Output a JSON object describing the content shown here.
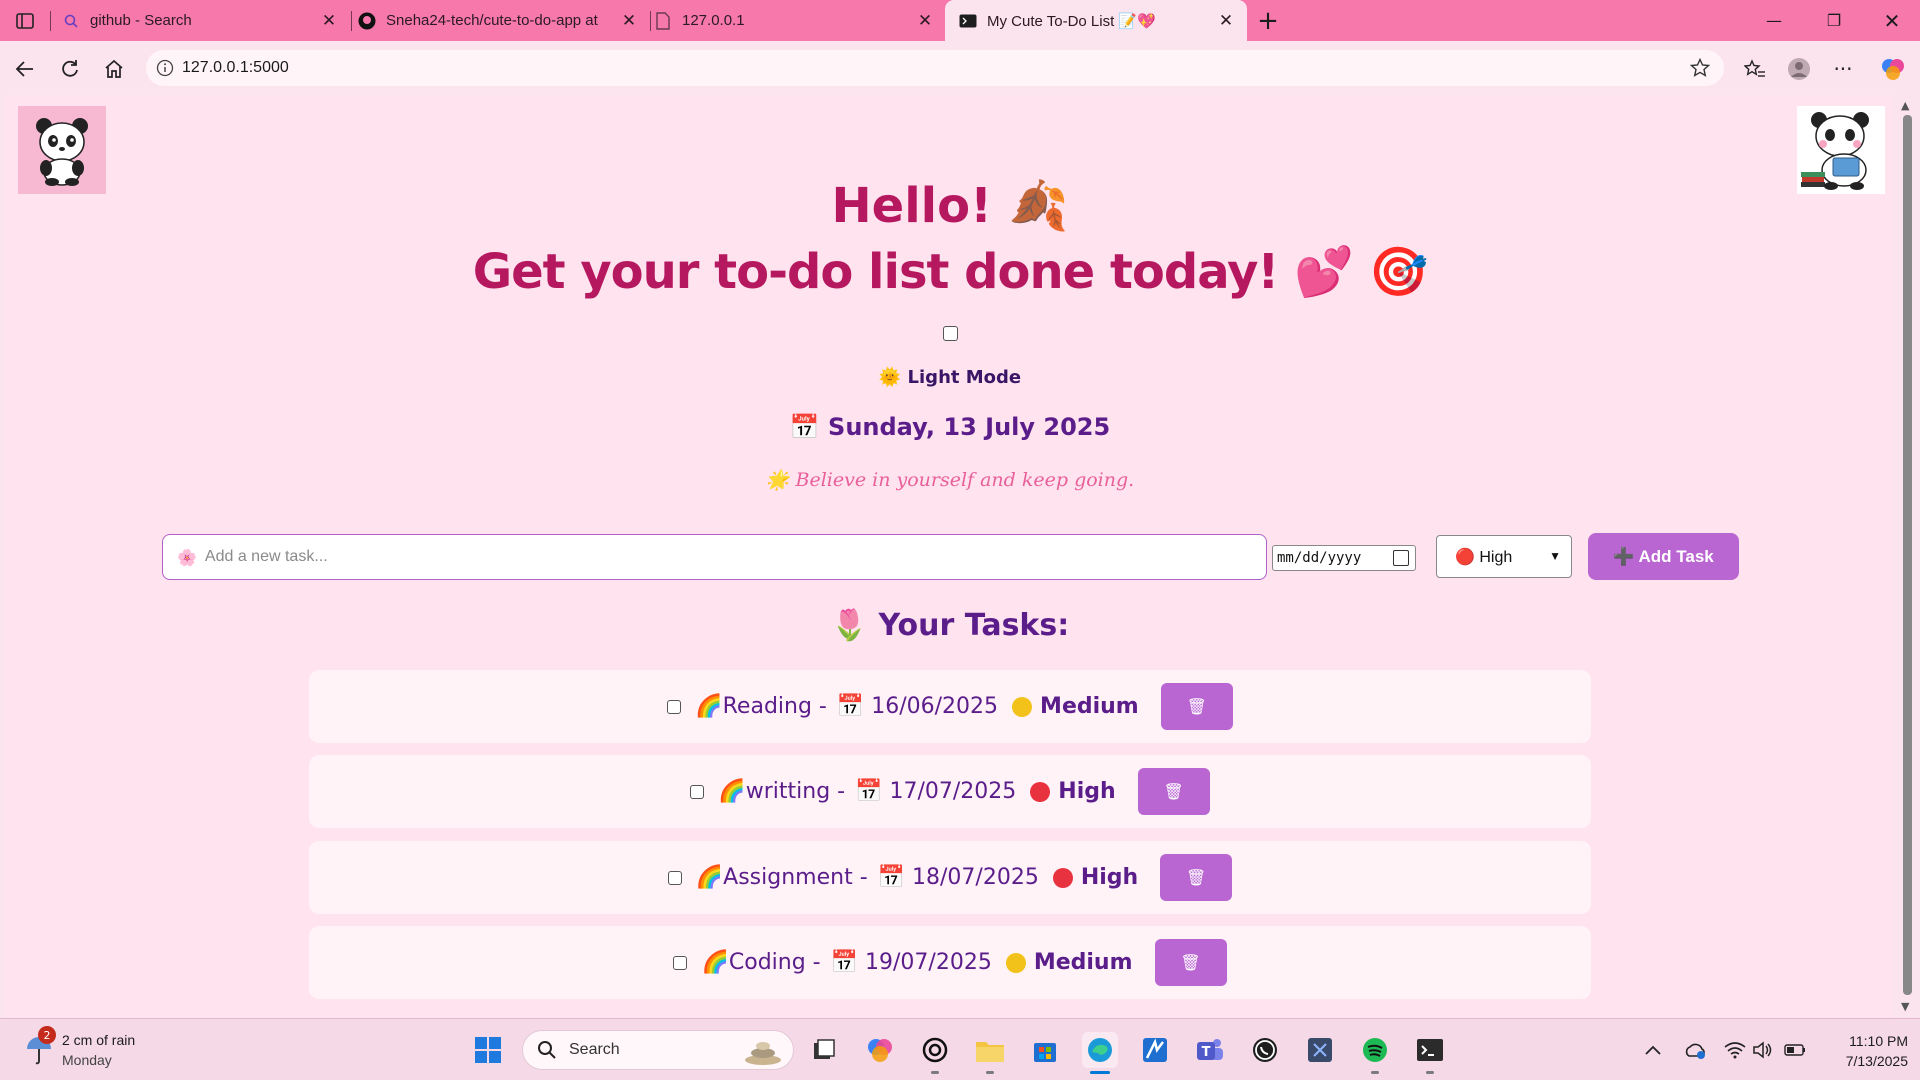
{
  "browser": {
    "tabs": [
      {
        "title": "github - Search",
        "icon": "search-icon"
      },
      {
        "title": "Sneha24-tech/cute-to-do-app at",
        "icon": "github-icon"
      },
      {
        "title": "127.0.0.1",
        "icon": "document-icon"
      },
      {
        "title": "My Cute To-Do List 📝💖",
        "icon": "terminal-icon",
        "active": true
      }
    ],
    "url": "127.0.0.1:5000"
  },
  "page": {
    "greeting": "Hello! 🍂",
    "headline": "Get your to-do list done today! 💕 🎯",
    "mode_label": "🌞 Light Mode",
    "date_label": "📅 Sunday, 13 July 2025",
    "quote": "🌟 Believe in yourself and keep going.",
    "form": {
      "task_icon": "🌸",
      "task_placeholder": "Add a new task...",
      "date_placeholder": "mm/dd/yyyy",
      "priority_selected": "🔴 High",
      "add_button": "➕ Add Task"
    },
    "tasks_heading": "🌷 Your Tasks:",
    "tasks": [
      {
        "name": "🌈Reading -",
        "date": "📅 16/06/2025",
        "priority": "Medium",
        "priority_color": "#f2c21b",
        "delete": "🗑"
      },
      {
        "name": "🌈writting -",
        "date": "📅 17/07/2025",
        "priority": "High",
        "priority_color": "#e8323f",
        "delete": "🗑"
      },
      {
        "name": "🌈Assignment -",
        "date": "📅 18/07/2025",
        "priority": "High",
        "priority_color": "#e8323f",
        "delete": "🗑"
      },
      {
        "name": "🌈Coding -",
        "date": "📅 19/07/2025",
        "priority": "Medium",
        "priority_color": "#f2c21b",
        "delete": "🗑"
      }
    ]
  },
  "taskbar": {
    "weather_badge": "2",
    "weather_line1": "2 cm of rain",
    "weather_line2": "Monday",
    "search_label": "Search",
    "time": "11:10 PM",
    "date": "7/13/2025"
  },
  "colors": {
    "accent": "#b5185f",
    "button": "#b966d2",
    "tab_strip": "#f778ab",
    "page_bg": "#ffe3ef"
  }
}
